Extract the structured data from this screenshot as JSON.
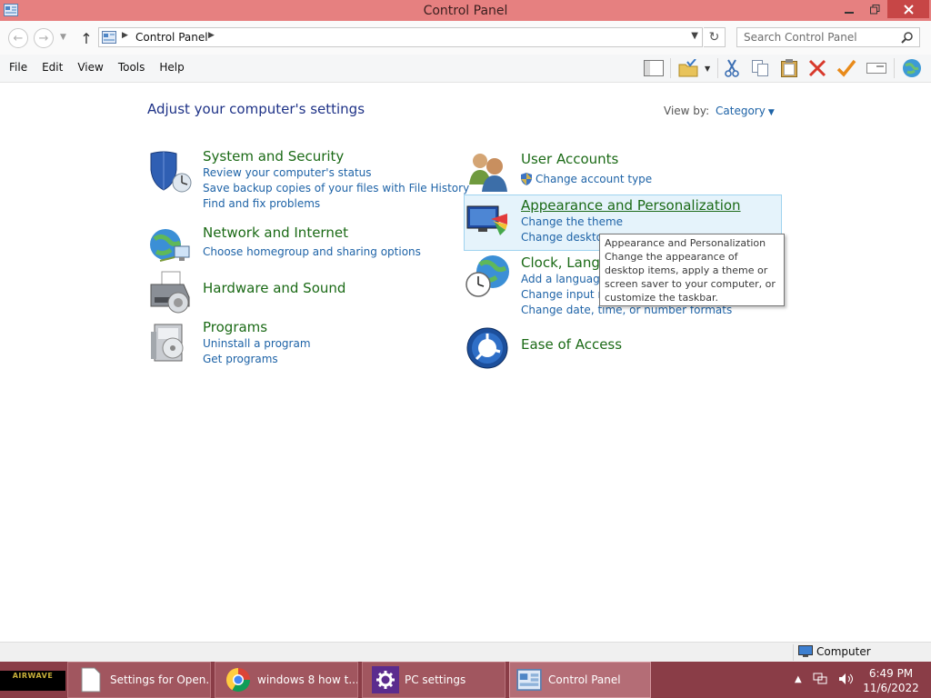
{
  "window": {
    "title": "Control Panel"
  },
  "address": {
    "breadcrumb": "Control Panel"
  },
  "search": {
    "placeholder": "Search Control Panel"
  },
  "menu": [
    "File",
    "Edit",
    "View",
    "Tools",
    "Help"
  ],
  "main": {
    "heading": "Adjust your computer's settings",
    "view_by_label": "View by:",
    "view_by_value": "Category"
  },
  "categories": {
    "system": {
      "title": "System and Security",
      "links": [
        "Review your computer's status",
        "Save backup copies of your files with File History",
        "Find and fix problems"
      ]
    },
    "network": {
      "title": "Network and Internet",
      "links": [
        "Choose homegroup and sharing options"
      ]
    },
    "hardware": {
      "title": "Hardware and Sound"
    },
    "programs": {
      "title": "Programs",
      "links": [
        "Uninstall a program",
        "Get programs"
      ]
    },
    "users": {
      "title": "User Accounts",
      "links": [
        "Change account type"
      ]
    },
    "appearance": {
      "title": "Appearance and Personalization",
      "links": [
        "Change the theme",
        "Change desktop"
      ]
    },
    "clock": {
      "title": "Clock, Langu",
      "links": [
        "Add a language",
        "Change input m",
        "Change date, time, or number formats"
      ]
    },
    "ease": {
      "title": "Ease of Access"
    }
  },
  "tooltip": {
    "title": "Appearance and Personalization",
    "body": "Change the appearance of desktop items, apply a theme or screen saver to your computer, or customize the taskbar."
  },
  "statusbar": {
    "location": "Computer"
  },
  "taskbar": {
    "start_logo": "AIRWAVE",
    "tasks": [
      {
        "label": "Settings for Open..."
      },
      {
        "label": "windows 8 how t..."
      },
      {
        "label": "PC settings"
      },
      {
        "label": "Control Panel"
      }
    ],
    "clock_time": "6:49 PM",
    "clock_date": "11/6/2022"
  },
  "colors": {
    "titlebar": "#e68080",
    "taskbar": "#8a3d47",
    "link": "#1e63a7",
    "category_title": "#1b6a16",
    "heading": "#1e3287"
  }
}
